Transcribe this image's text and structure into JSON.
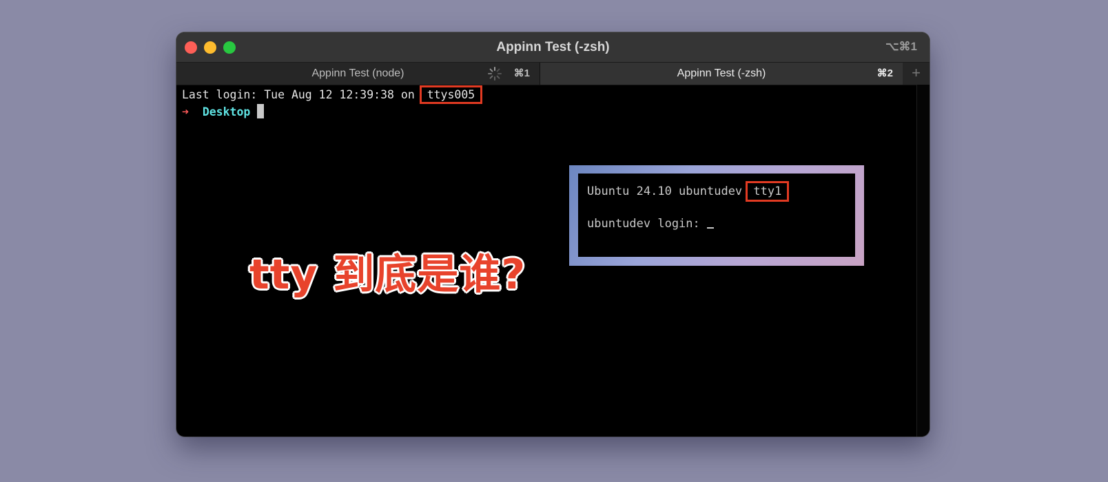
{
  "window": {
    "title": "Appinn Test (-zsh)",
    "shortcut": "⌥⌘1",
    "tabs": [
      {
        "label": "Appinn Test (node)",
        "key": "⌘1",
        "active": false,
        "busy": true
      },
      {
        "label": "Appinn Test (-zsh)",
        "key": "⌘2",
        "active": true
      }
    ],
    "add_tab": "+"
  },
  "terminal": {
    "login_prefix": "Last login: Tue Aug 12 12:39:38 on ",
    "login_tty": "ttys005",
    "prompt_arrow": "➜",
    "prompt_dir": "Desktop"
  },
  "inset": {
    "line1_prefix": "Ubuntu 24.10 ubuntudev ",
    "line1_tty": "tty1",
    "line2": "ubuntudev login: "
  },
  "overlay": {
    "title": "tty 到底是谁?"
  },
  "colors": {
    "accent_red": "#e13a22",
    "prompt_arrow": "#ff5a5a",
    "prompt_dir": "#5fe3e3",
    "background": "#8a8aa6"
  }
}
